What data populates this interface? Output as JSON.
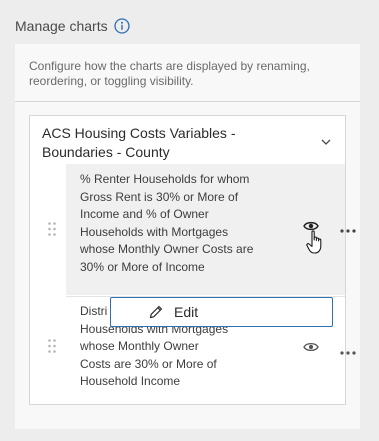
{
  "header": {
    "title": "Manage charts",
    "info_icon": "info-circle-icon"
  },
  "panel": {
    "description": "Configure how the charts are displayed by renaming, reordering, or toggling visibility."
  },
  "group": {
    "title": "ACS Housing Costs Variables - Boundaries - County",
    "expanded": true,
    "items": [
      {
        "label": "% Renter Households for whom Gross Rent is 30% or More of Income and % of Owner Households with Mortgages whose Monthly Owner Costs are 30% or More of Income",
        "visible": true
      },
      {
        "label_line1": "Distri",
        "label_line2": "Housenolds with Mortgages",
        "label_line3": "whose Monthly Owner",
        "label_line4": "Costs are 30% or More of",
        "label_line5": "Household Income",
        "visible": true
      }
    ]
  },
  "menu": {
    "edit_label": "Edit"
  },
  "colors": {
    "accent": "#2f6fb6",
    "background": "#ededed",
    "panel": "#f8f8f8"
  }
}
